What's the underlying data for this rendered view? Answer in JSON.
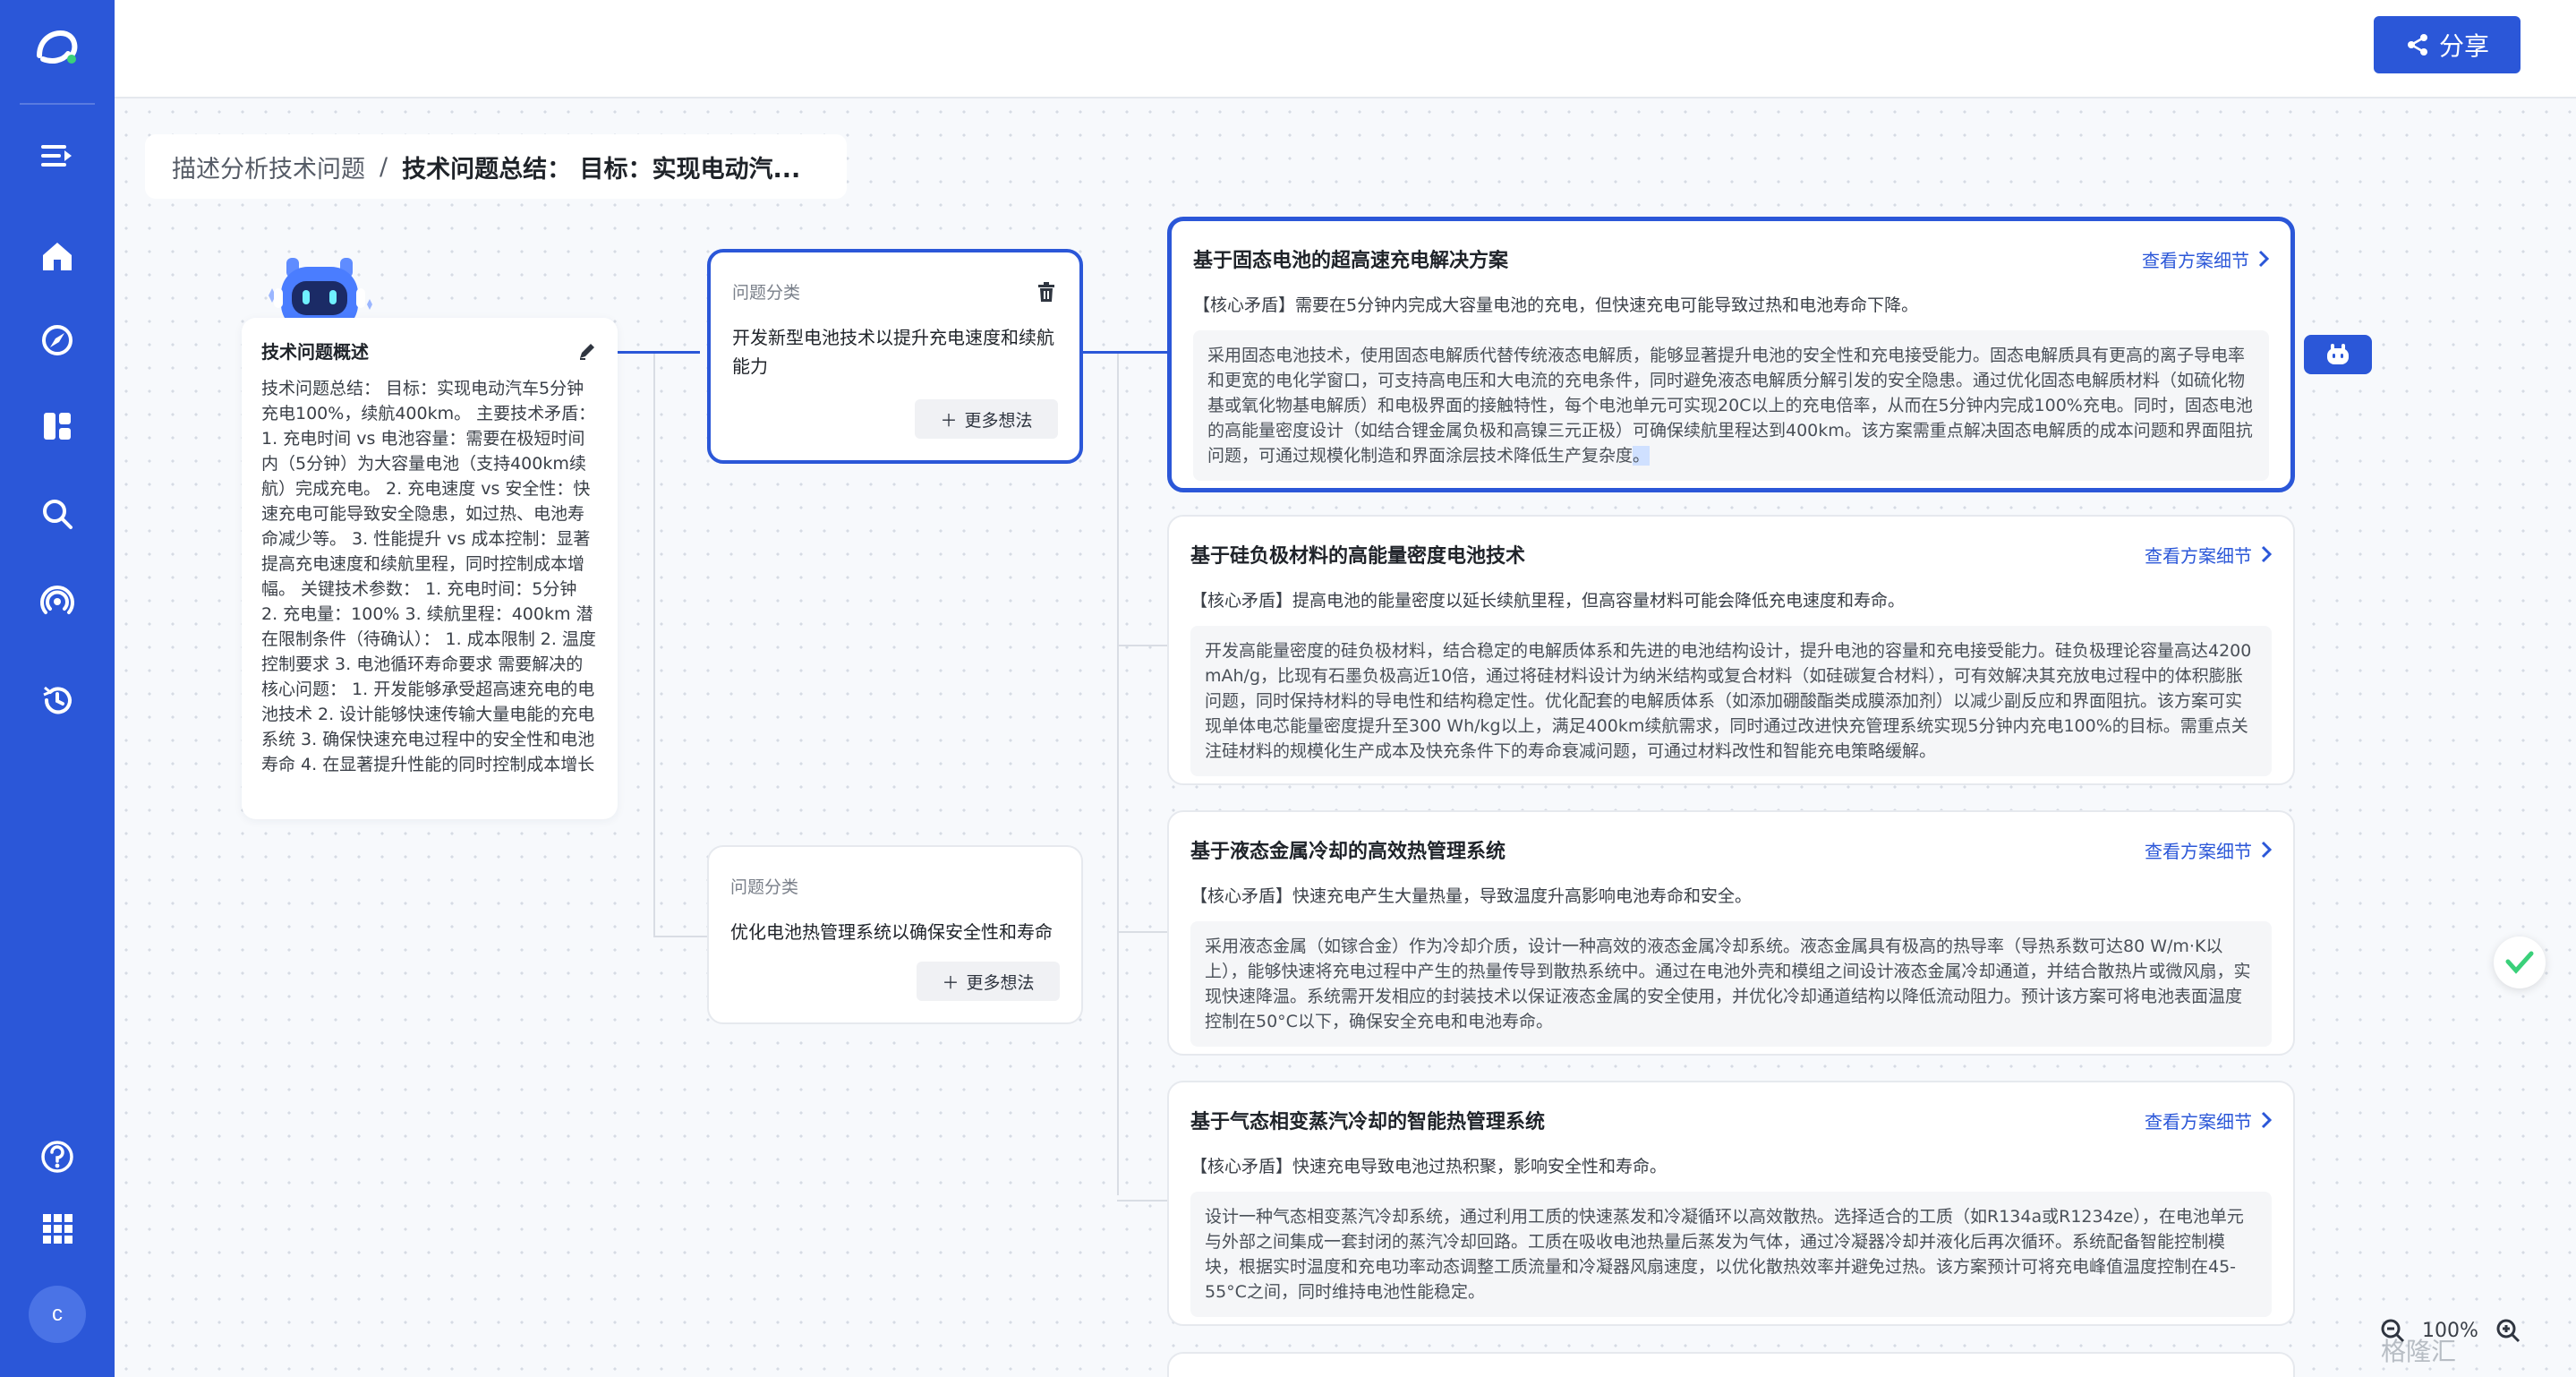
{
  "topbar": {
    "share_label": "分享"
  },
  "breadcrumb": {
    "root": "描述分析技术问题",
    "separator": "/",
    "current": "技术问题总结： 目标：实现电动汽..."
  },
  "overview": {
    "title": "技术问题概述",
    "text": "技术问题总结： 目标：实现电动汽车5分钟充电100%，续航400km。 主要技术矛盾： 1. 充电时间 vs 电池容量：需要在极短时间内（5分钟）为大容量电池（支持400km续航）完成充电。 2. 充电速度 vs 安全性：快速充电可能导致安全隐患，如过热、电池寿命减少等。 3. 性能提升 vs 成本控制：显著提高充电速度和续航里程，同时控制成本增幅。 关键技术参数： 1. 充电时间：5分钟 2. 充电量：100% 3. 续航里程：400km 潜在限制条件（待确认）： 1. 成本限制 2. 温度控制要求 3. 电池循环寿命要求 需要解决的核心问题： 1. 开发能够承受超高速充电的电池技术 2. 设计能够快速传输大量电能的充电系统 3. 确保快速充电过程中的安全性和电池寿命 4. 在显著提升性能的同时控制成本增长"
  },
  "categories": [
    {
      "label": "问题分类",
      "text": "开发新型电池技术以提升充电速度和续航能力",
      "more_label": "更多想法"
    },
    {
      "label": "问题分类",
      "text": "优化电池热管理系统以确保安全性和寿命",
      "more_label": "更多想法"
    }
  ],
  "solutions": [
    {
      "title": "基于固态电池的超高速充电解决方案",
      "link": "查看方案细节",
      "conflict": "【核心矛盾】需要在5分钟内完成大容量电池的充电，但快速充电可能导致过热和电池寿命下降。",
      "desc": "采用固态电池技术，使用固态电解质代替传统液态电解质，能够显著提升电池的安全性和充电接受能力。固态电解质具有更高的离子导电率和更宽的电化学窗口，可支持高电压和大电流的充电条件，同时避免液态电解质分解引发的安全隐患。通过优化固态电解质材料（如硫化物基或氧化物基电解质）和电极界面的接触特性，每个电池单元可实现20C以上的充电倍率，从而在5分钟内完成100%充电。同时，固态电池的高能量密度设计（如结合锂金属负极和高镍三元正极）可确保续航里程达到400km。该方案需重点解决固态电解质的成本问题和界面阻抗问题，可通过规模化制造和界面涂层技术降低生产复杂度",
      "desc_tail": "。"
    },
    {
      "title": "基于硅负极材料的高能量密度电池技术",
      "link": "查看方案细节",
      "conflict": "【核心矛盾】提高电池的能量密度以延长续航里程，但高容量材料可能会降低充电速度和寿命。",
      "desc": "开发高能量密度的硅负极材料，结合稳定的电解质体系和先进的电池结构设计，提升电池的容量和充电接受能力。硅负极理论容量高达4200 mAh/g，比现有石墨负极高近10倍，通过将硅材料设计为纳米结构或复合材料（如硅碳复合材料），可有效解决其充放电过程中的体积膨胀问题，同时保持材料的导电性和结构稳定性。优化配套的电解质体系（如添加硼酸酯类成膜添加剂）以减少副反应和界面阻抗。该方案可实现单体电芯能量密度提升至300 Wh/kg以上，满足400km续航需求，同时通过改进快充管理系统实现5分钟内充电100%的目标。需重点关注硅材料的规模化生产成本及快充条件下的寿命衰减问题，可通过材料改性和智能充电策略缓解。",
      "desc_tail": ""
    },
    {
      "title": "基于液态金属冷却的高效热管理系统",
      "link": "查看方案细节",
      "conflict": "【核心矛盾】快速充电产生大量热量，导致温度升高影响电池寿命和安全。",
      "desc": "采用液态金属（如镓合金）作为冷却介质，设计一种高效的液态金属冷却系统。液态金属具有极高的热导率（导热系数可达80 W/m·K以上），能够快速将充电过程中产生的热量传导到散热系统中。通过在电池外壳和模组之间设计液态金属冷却通道，并结合散热片或微风扇，实现快速降温。系统需开发相应的封装技术以保证液态金属的安全使用，并优化冷却通道结构以降低流动阻力。预计该方案可将电池表面温度控制在50°C以下，确保安全充电和电池寿命。",
      "desc_tail": ""
    },
    {
      "title": "基于气态相变蒸汽冷却的智能热管理系统",
      "link": "查看方案细节",
      "conflict": "【核心矛盾】快速充电导致电池过热积聚，影响安全性和寿命。",
      "desc": "设计一种气态相变蒸汽冷却系统，通过利用工质的快速蒸发和冷凝循环以高效散热。选择适合的工质（如R134a或R1234ze），在电池单元与外部之间集成一套封闭的蒸汽冷却回路。工质在吸收电池热量后蒸发为气体，通过冷凝器冷却并液化后再次循环。系统配备智能控制模块，根据实时温度和充电功率动态调整工质流量和冷凝器风扇速度，以优化散热效率并避免过热。该方案预计可将充电峰值温度控制在45-55°C之间，同时维持电池性能稳定。",
      "desc_tail": ""
    }
  ],
  "zoom": {
    "level": "100%"
  },
  "watermark": "格隆汇",
  "avatar_initial": "c"
}
